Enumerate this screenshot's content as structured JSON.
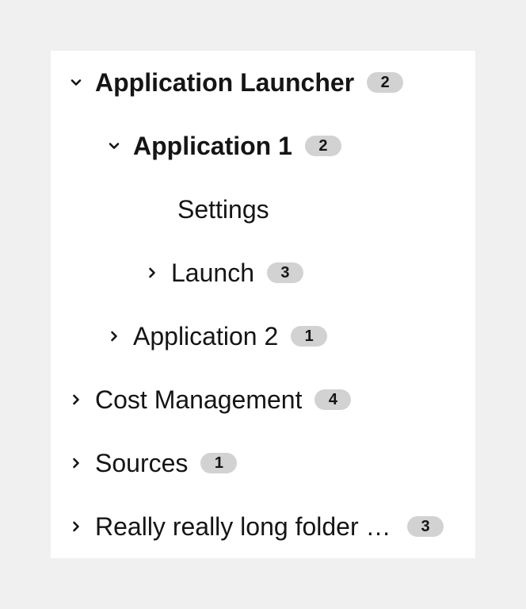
{
  "tree": {
    "items": [
      {
        "label": "Application Launcher",
        "badge": "2",
        "expanded": true,
        "level": 0,
        "bold": true,
        "hasChildren": true
      },
      {
        "label": "Application 1",
        "badge": "2",
        "expanded": true,
        "level": 1,
        "bold": true,
        "hasChildren": true
      },
      {
        "label": "Settings",
        "badge": "",
        "expanded": false,
        "level": 2,
        "bold": false,
        "hasChildren": false
      },
      {
        "label": "Launch",
        "badge": "3",
        "expanded": false,
        "level": 2,
        "bold": false,
        "hasChildren": true
      },
      {
        "label": "Application 2",
        "badge": "1",
        "expanded": false,
        "level": 1,
        "bold": false,
        "hasChildren": true
      },
      {
        "label": "Cost Management",
        "badge": "4",
        "expanded": false,
        "level": 0,
        "bold": false,
        "hasChildren": true
      },
      {
        "label": "Sources",
        "badge": "1",
        "expanded": false,
        "level": 0,
        "bold": false,
        "hasChildren": true
      },
      {
        "label": "Really really long folder n...",
        "badge": "3",
        "expanded": false,
        "level": 0,
        "bold": false,
        "hasChildren": true
      }
    ]
  },
  "icons": {
    "expanded": "angle-down-icon",
    "collapsed": "angle-right-icon"
  },
  "colors": {
    "text": "#151515",
    "badge_bg": "#d2d2d2",
    "panel_bg": "#ffffff",
    "page_bg": "#f0f0f0"
  }
}
